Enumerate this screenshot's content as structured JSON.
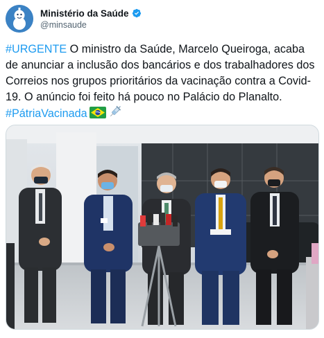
{
  "account": {
    "display_name": "Ministério da Saúde",
    "handle": "@minsaude",
    "verified": true,
    "avatar_icon": "vaccine-mascot-avatar-icon",
    "brand_color": "#3b82c4"
  },
  "tweet": {
    "hashtag_urgent": "#URGENTE",
    "body": " O ministro da Saúde, Marcelo Queiroga, acaba de anunciar a inclusão dos bancários e dos trabalhadores dos Correios nos grupos prioritários da vacinação contra a Covid-19. O anúncio foi feito há pouco no Palácio do Planalto. ",
    "hashtag_patria": "#PátriaVacinada",
    "emoji_flag": "brazil-flag-icon",
    "emoji_syringe": "syringe-icon",
    "link_color": "#1d9bf0"
  },
  "media": {
    "type": "photo",
    "icon": "press-conference-photo"
  }
}
